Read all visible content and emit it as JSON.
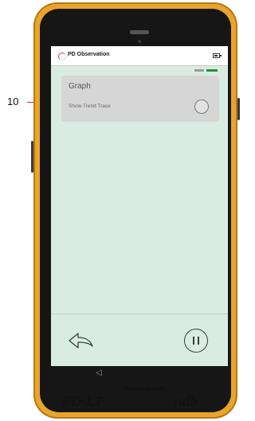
{
  "app": {
    "title": "PD Observation"
  },
  "status_indicators": {
    "left_color": "#9a9a9a",
    "right_color": "#2d8c3c"
  },
  "graph_card": {
    "title": "Graph",
    "subtitle": "Show Trend Trace",
    "toggle_checked": false
  },
  "footer": {
    "back_icon": "back-arrow-icon",
    "pause_icon": "pause-icon"
  },
  "android_nav": {
    "back_icon": "triangle-back-icon"
  },
  "device": {
    "module_label": "Display Module",
    "model": "PD-LT",
    "brand": "ndb",
    "frame_color": "#e8a42c"
  },
  "callout": {
    "number": "10",
    "line_color": "#c0362f"
  }
}
